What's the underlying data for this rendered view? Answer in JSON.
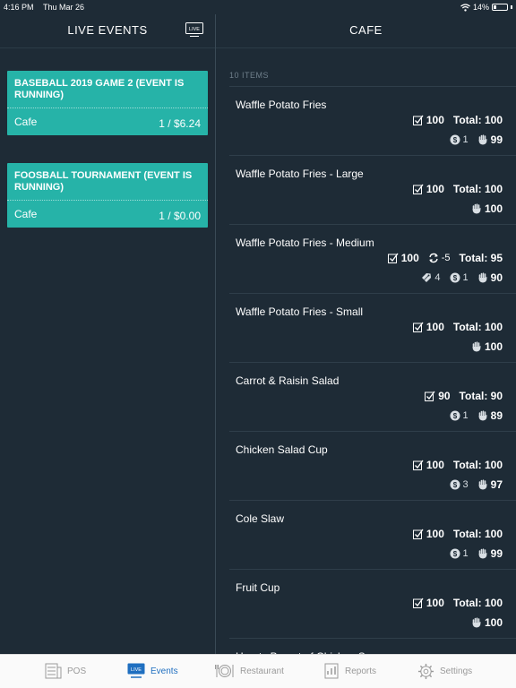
{
  "status_bar": {
    "time": "4:16 PM",
    "date": "Thu Mar 26",
    "battery": "14%"
  },
  "left": {
    "title": "LIVE EVENTS",
    "live_icon_text": "LIVE",
    "events": [
      {
        "name": "BASEBALL 2019 GAME 2 (EVENT IS RUNNING)",
        "location": "Cafe",
        "summary": "1 / $6.24"
      },
      {
        "name": "FOOSBALL TOURNAMENT (EVENT IS RUNNING)",
        "location": "Cafe",
        "summary": "1 / $0.00"
      }
    ]
  },
  "right": {
    "title": "CAFE",
    "items_count": "10 ITEMS",
    "items": [
      {
        "name": "Waffle Potato Fries",
        "checked": "100",
        "adjust": "",
        "total": "Total: 100",
        "tags": "",
        "sold": "1",
        "hand": "99"
      },
      {
        "name": "Waffle Potato Fries - Large",
        "checked": "100",
        "adjust": "",
        "total": "Total: 100",
        "tags": "",
        "sold": "",
        "hand": "100"
      },
      {
        "name": "Waffle Potato Fries - Medium",
        "checked": "100",
        "adjust": "-5",
        "total": "Total: 95",
        "tags": "4",
        "sold": "1",
        "hand": "90"
      },
      {
        "name": "Waffle Potato Fries - Small",
        "checked": "100",
        "adjust": "",
        "total": "Total: 100",
        "tags": "",
        "sold": "",
        "hand": "100"
      },
      {
        "name": "Carrot & Raisin Salad",
        "checked": "90",
        "adjust": "",
        "total": "Total: 90",
        "tags": "",
        "sold": "1",
        "hand": "89"
      },
      {
        "name": "Chicken Salad Cup",
        "checked": "100",
        "adjust": "",
        "total": "Total: 100",
        "tags": "",
        "sold": "3",
        "hand": "97"
      },
      {
        "name": "Cole Slaw",
        "checked": "100",
        "adjust": "",
        "total": "Total: 100",
        "tags": "",
        "sold": "1",
        "hand": "99"
      },
      {
        "name": "Fruit Cup",
        "checked": "100",
        "adjust": "",
        "total": "Total: 100",
        "tags": "",
        "sold": "",
        "hand": "100"
      },
      {
        "name": "Hearty Breast of Chicken Soup",
        "checked": "",
        "adjust": "",
        "total": "",
        "tags": "",
        "sold": "",
        "hand": ""
      }
    ]
  },
  "tabs": [
    {
      "label": "POS",
      "icon": "pos-icon"
    },
    {
      "label": "Events",
      "icon": "live-icon",
      "active": true
    },
    {
      "label": "Restaurant",
      "icon": "plate-icon"
    },
    {
      "label": "Reports",
      "icon": "report-icon"
    },
    {
      "label": "Settings",
      "icon": "gear-icon"
    }
  ],
  "colors": {
    "accent": "#26b3a8",
    "background": "#1e2b36",
    "tab_active": "#1f6fc0"
  }
}
